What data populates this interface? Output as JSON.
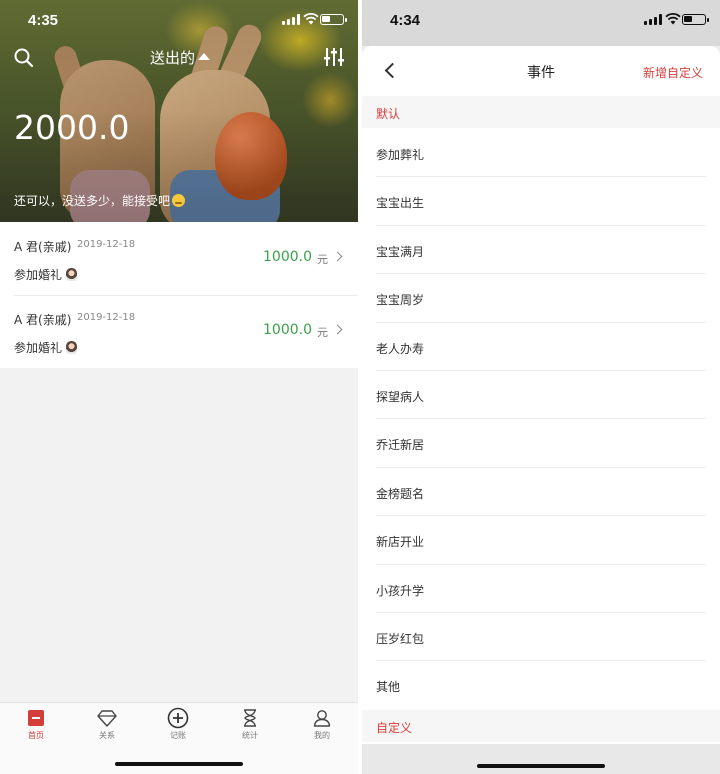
{
  "left": {
    "status": {
      "time": "4:35"
    },
    "header": {
      "mode_label": "送出的",
      "total": "2000.0",
      "caption": "还可以，没送多少，能接受吧"
    },
    "records": [
      {
        "name": "A 君(亲戚)",
        "date": "2019-12-18",
        "event": "参加婚礼",
        "amount": "1000.0",
        "unit": "元"
      },
      {
        "name": "A 君(亲戚)",
        "date": "2019-12-18",
        "event": "参加婚礼",
        "amount": "1000.0",
        "unit": "元"
      }
    ],
    "tabs": [
      {
        "label": "首页",
        "icon": "home-icon",
        "active": true
      },
      {
        "label": "关系",
        "icon": "diamond-icon",
        "active": false
      },
      {
        "label": "记账",
        "icon": "plus-circle-icon",
        "active": false
      },
      {
        "label": "统计",
        "icon": "hourglass-icon",
        "active": false
      },
      {
        "label": "我的",
        "icon": "user-icon",
        "active": false
      }
    ]
  },
  "right": {
    "status": {
      "time": "4:34"
    },
    "nav": {
      "title": "事件",
      "action": "新增自定义"
    },
    "sections": {
      "default": "默认",
      "custom": "自定义"
    },
    "events": [
      "参加葬礼",
      "宝宝出生",
      "宝宝满月",
      "宝宝周岁",
      "老人办寿",
      "探望病人",
      "乔迁新居",
      "金榜题名",
      "新店开业",
      "小孩升学",
      "压岁红包",
      "其他"
    ]
  },
  "colors": {
    "accent": "#d43e3a",
    "amount_green": "#3aa14a"
  }
}
